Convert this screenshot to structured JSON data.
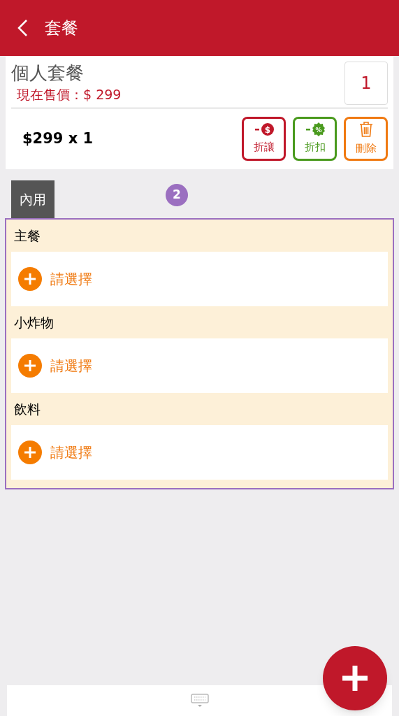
{
  "header": {
    "title": "套餐"
  },
  "item": {
    "name": "個人套餐",
    "price_label": "現在售價：$ 299",
    "quantity": "1",
    "subtotal": "$299 x 1",
    "actions": [
      {
        "kind": "amount",
        "label": "折讓",
        "icon_glyph": "$"
      },
      {
        "kind": "percent",
        "label": "折扣",
        "icon_glyph": "%"
      },
      {
        "kind": "delete",
        "label": "刪除"
      }
    ]
  },
  "tabs": [
    {
      "label": "內用",
      "selected": true
    }
  ],
  "badge": "2",
  "groups": [
    {
      "title": "主餐",
      "choice": "請選擇"
    },
    {
      "title": "小炸物",
      "choice": "請選擇"
    },
    {
      "title": "飲料",
      "choice": "請選擇"
    }
  ]
}
